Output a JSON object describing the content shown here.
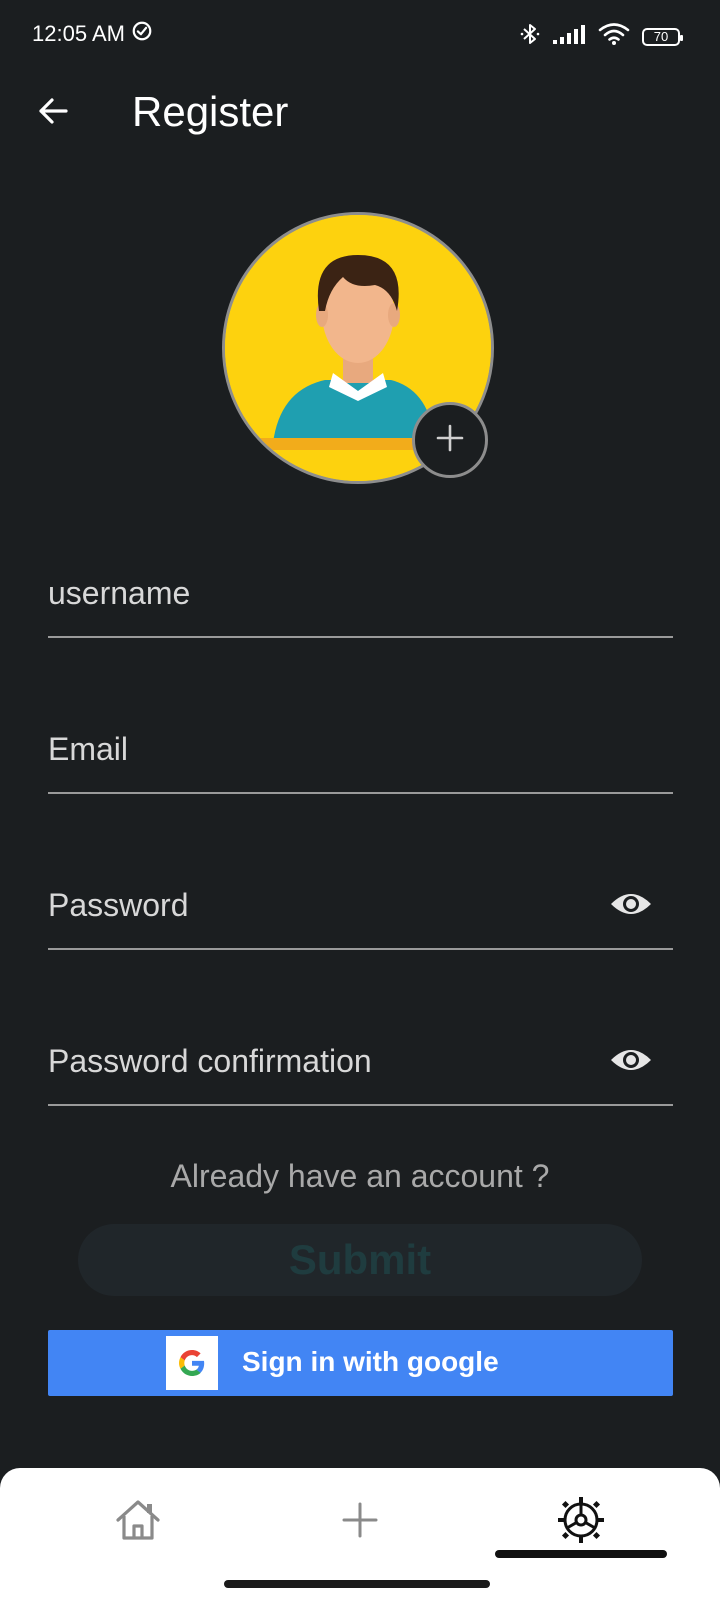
{
  "status_bar": {
    "time": "12:05 AM",
    "battery": "70",
    "icons": [
      "check-circle-icon",
      "bluetooth-icon",
      "signal-icon",
      "wifi-icon",
      "battery-icon"
    ]
  },
  "app_bar": {
    "title": "Register",
    "back_icon": "arrow-left-icon"
  },
  "avatar": {
    "add_icon": "plus-icon",
    "background": "#fdd20e"
  },
  "form": {
    "username": {
      "placeholder": "username",
      "value": ""
    },
    "email": {
      "placeholder": "Email",
      "value": ""
    },
    "password": {
      "placeholder": "Password",
      "value": "",
      "icon": "eye-icon"
    },
    "password_confirmation": {
      "placeholder": "Password confirmation",
      "value": "",
      "icon": "eye-icon"
    }
  },
  "login_link": "Already have an account ?",
  "submit_label": "Submit",
  "google_button": {
    "label": "Sign in with google",
    "color": "#4285f4"
  },
  "bottom_nav": {
    "items": [
      {
        "icon": "home-icon"
      },
      {
        "icon": "plus-icon"
      },
      {
        "icon": "settings-icon",
        "active": true
      }
    ]
  },
  "colors": {
    "background": "#1b1e20",
    "text": "#e6e6e6",
    "muted": "#a9a9a9",
    "accent": "#4285f4"
  }
}
